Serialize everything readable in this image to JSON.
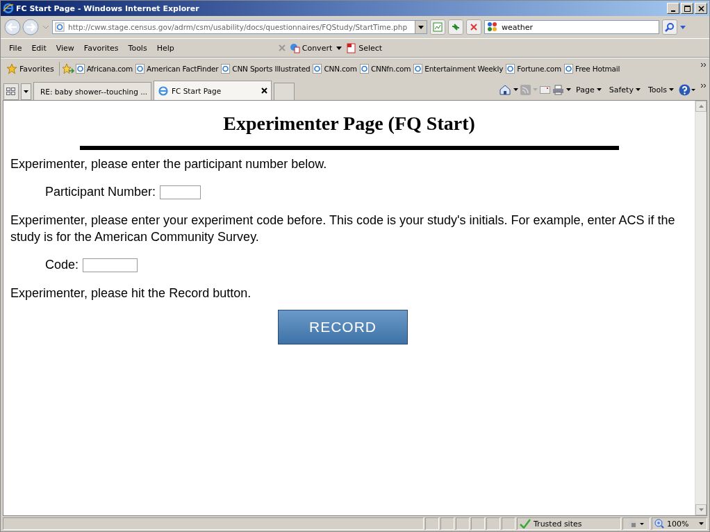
{
  "window": {
    "title": "FC Start Page - Windows Internet Explorer"
  },
  "address_bar": {
    "url": "http://cww.stage.census.gov/adrm/csm/usability/docs/questionnaires/FQStudy/StartTime.php"
  },
  "search": {
    "value": "weather"
  },
  "menu": [
    "File",
    "Edit",
    "View",
    "Favorites",
    "Tools",
    "Help"
  ],
  "toolbar": [
    "Convert",
    "Select"
  ],
  "favorites_bar": {
    "label": "Favorites",
    "links": [
      "Africana.com",
      "American FactFinder",
      "CNN Sports Illustrated",
      "CNN.com",
      "CNNfn.com",
      "Entertainment Weekly",
      "Fortune.com",
      "Free Hotmail"
    ]
  },
  "tabs": [
    {
      "label": "RE: baby shower--touching ...",
      "selected": false
    },
    {
      "label": "FC Start Page",
      "selected": true
    }
  ],
  "command_bar": [
    "Page",
    "Safety",
    "Tools"
  ],
  "page": {
    "heading": "Experimenter Page (FQ Start)",
    "instruction_1": "Experimenter, please enter the participant number below.",
    "participant_label": "Participant Number:",
    "instruction_2": "Experimenter, please enter your experiment code before. This code is your study's initials. For example, enter ACS if the study is for the American Community Survey.",
    "code_label": "Code:",
    "instruction_3": "Experimenter, please hit the Record button.",
    "record_button": "RECORD"
  },
  "status_bar": {
    "zone": "Trusted sites",
    "zoom": "100%"
  }
}
